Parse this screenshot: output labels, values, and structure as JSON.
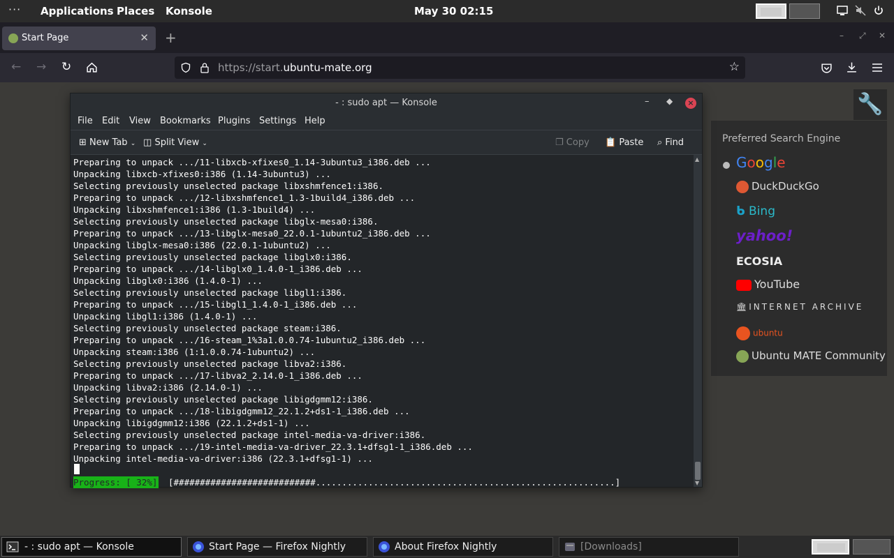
{
  "top_panel": {
    "menus": [
      "Applications",
      "Places",
      "Konsole"
    ],
    "clock": "May 30  02:15"
  },
  "firefox": {
    "tab_label": "Start Page",
    "url_scheme": "https://start.",
    "url_host": "ubuntu-mate.org"
  },
  "search_engines": {
    "heading": "Preferred Search Engine",
    "items": [
      "Google",
      "DuckDuckGo",
      "Bing",
      "yahoo!",
      "ECOSIA",
      "YouTube",
      "INTERNET ARCHIVE",
      "ubuntu",
      "Ubuntu MATE Community"
    ],
    "selected": "Google"
  },
  "konsole": {
    "title": "- : sudo apt — Konsole",
    "menu": [
      "File",
      "Edit",
      "View",
      "Bookmarks",
      "Plugins",
      "Settings",
      "Help"
    ],
    "toolbar": {
      "new_tab": "New Tab",
      "split_view": "Split View",
      "copy": "Copy",
      "paste": "Paste",
      "find": "Find"
    },
    "lines": [
      "Preparing to unpack .../11-libxcb-xfixes0_1.14-3ubuntu3_i386.deb ...",
      "Unpacking libxcb-xfixes0:i386 (1.14-3ubuntu3) ...",
      "Selecting previously unselected package libxshmfence1:i386.",
      "Preparing to unpack .../12-libxshmfence1_1.3-1build4_i386.deb ...",
      "Unpacking libxshmfence1:i386 (1.3-1build4) ...",
      "Selecting previously unselected package libglx-mesa0:i386.",
      "Preparing to unpack .../13-libglx-mesa0_22.0.1-1ubuntu2_i386.deb ...",
      "Unpacking libglx-mesa0:i386 (22.0.1-1ubuntu2) ...",
      "Selecting previously unselected package libglx0:i386.",
      "Preparing to unpack .../14-libglx0_1.4.0-1_i386.deb ...",
      "Unpacking libglx0:i386 (1.4.0-1) ...",
      "Selecting previously unselected package libgl1:i386.",
      "Preparing to unpack .../15-libgl1_1.4.0-1_i386.deb ...",
      "Unpacking libgl1:i386 (1.4.0-1) ...",
      "Selecting previously unselected package steam:i386.",
      "Preparing to unpack .../16-steam_1%3a1.0.0.74-1ubuntu2_i386.deb ...",
      "Unpacking steam:i386 (1:1.0.0.74-1ubuntu2) ...",
      "Selecting previously unselected package libva2:i386.",
      "Preparing to unpack .../17-libva2_2.14.0-1_i386.deb ...",
      "Unpacking libva2:i386 (2.14.0-1) ...",
      "Selecting previously unselected package libigdgmm12:i386.",
      "Preparing to unpack .../18-libigdgmm12_22.1.2+ds1-1_i386.deb ...",
      "Unpacking libigdgmm12:i386 (22.1.2+ds1-1) ...",
      "Selecting previously unselected package intel-media-va-driver:i386.",
      "Preparing to unpack .../19-intel-media-va-driver_22.3.1+dfsg1-1_i386.deb ...",
      "Unpacking intel-media-va-driver:i386 (22.3.1+dfsg1-1) ..."
    ],
    "progress_label": "Progress: [ 32%]",
    "progress_bar": "[###########################.........................................................]",
    "progress_value": 0.32
  },
  "taskbar": [
    {
      "label": "- : sudo apt — Konsole"
    },
    {
      "label": "Start Page — Firefox Nightly"
    },
    {
      "label": "About Firefox Nightly"
    },
    {
      "label": "[Downloads]"
    }
  ],
  "colors": {
    "progress_green": "#18b218",
    "close_red": "#da4453",
    "panel": "#2b2b2b"
  }
}
